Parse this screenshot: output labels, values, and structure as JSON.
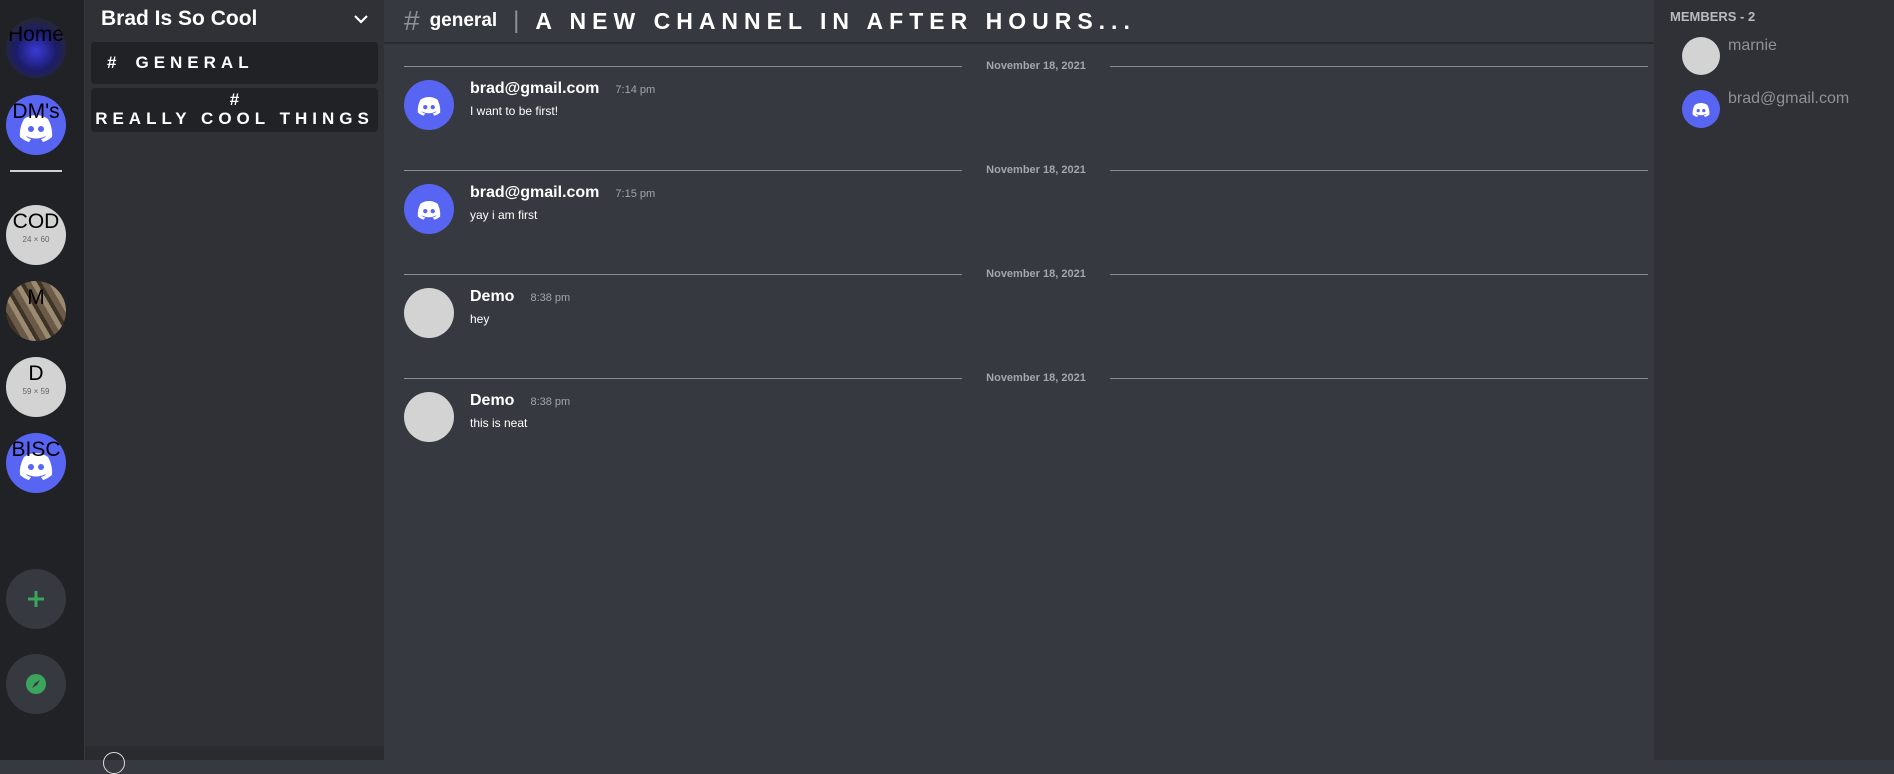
{
  "rail": {
    "servers": [
      {
        "label": "Home",
        "sub": ""
      },
      {
        "label": "DM's",
        "sub": ""
      },
      {
        "label": "COD",
        "sub": "24 × 60"
      },
      {
        "label": "M",
        "sub": ""
      },
      {
        "label": "D",
        "sub": "59 × 59"
      },
      {
        "label": "BISC",
        "sub": ""
      }
    ],
    "add_icon": "plus-icon",
    "explore_icon": "compass-icon",
    "colors": {
      "accent_green": "#3ba55d",
      "blurple": "#5865f2"
    }
  },
  "sidebar": {
    "server_name": "Brad Is So Cool",
    "channels": [
      {
        "hash": "#",
        "name": "GENERAL"
      },
      {
        "hash": "#",
        "name": "REALLY COOL THINGS"
      }
    ]
  },
  "header": {
    "hash": "#",
    "channel": "general",
    "separator": "|",
    "topic": "A NEW CHANNEL IN AFTER HOURS..."
  },
  "messages": [
    {
      "date": "November 18, 2021",
      "user": "brad@gmail.com",
      "time": "7:14 pm",
      "text": "I want to be first!",
      "avatar": "discord-logo"
    },
    {
      "date": "November 18, 2021",
      "user": "brad@gmail.com",
      "time": "7:15 pm",
      "text": "yay i am first",
      "avatar": "discord-logo"
    },
    {
      "date": "November 18, 2021",
      "user": "Demo",
      "time": "8:38 pm",
      "text": "hey",
      "avatar": "grey-circle"
    },
    {
      "date": "November 18, 2021",
      "user": "Demo",
      "time": "8:38 pm",
      "text": "this is neat",
      "avatar": "grey-circle"
    }
  ],
  "members": {
    "title": "MEMBERS - 2",
    "list": [
      {
        "name": "marnie",
        "avatar": "grey-circle"
      },
      {
        "name": "brad@gmail.com",
        "avatar": "discord-logo"
      }
    ]
  }
}
